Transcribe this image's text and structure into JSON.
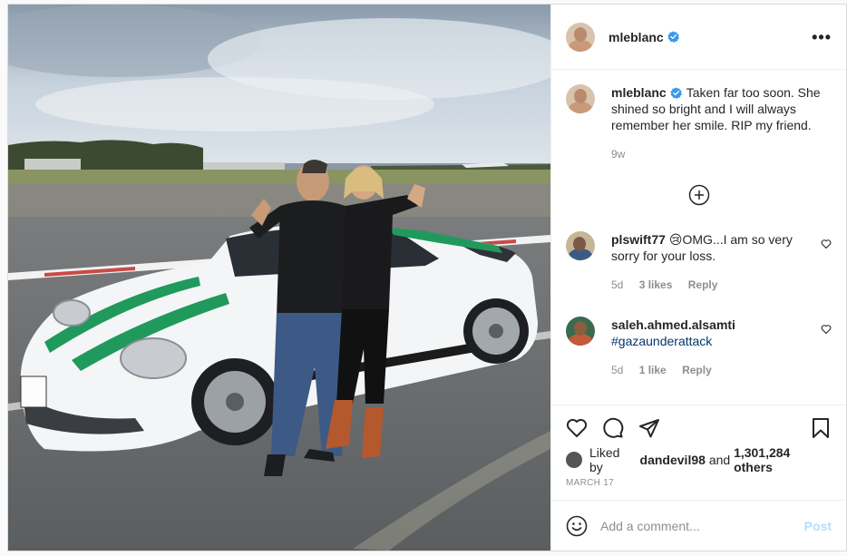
{
  "post": {
    "author": "mleblanc",
    "caption_author": "mleblanc",
    "caption": "Taken far too soon. She shined so bright and I will always remember her smile. RIP my friend.",
    "caption_age": "9w",
    "more_label": "•••"
  },
  "comments": [
    {
      "user": "plswift77",
      "text": "😢OMG...I am so very sorry for your loss.",
      "age": "5d",
      "likes": "3 likes",
      "reply": "Reply"
    },
    {
      "user": "saleh.ahmed.alsamti",
      "text": "#gazaunderattack",
      "age": "5d",
      "likes": "1 like",
      "reply": "Reply"
    }
  ],
  "likes": {
    "prefix": "Liked by",
    "first_user": "dandevil98",
    "conjunction": "and",
    "others": "1,301,284 others"
  },
  "date": "MARCH 17",
  "add_comment": {
    "placeholder": "Add a comment...",
    "post_label": "Post"
  },
  "colors": {
    "verified": "#3897f0",
    "hashtag": "#00376b",
    "post_disabled": "#b2dffc",
    "meta": "#8e8e8e"
  }
}
